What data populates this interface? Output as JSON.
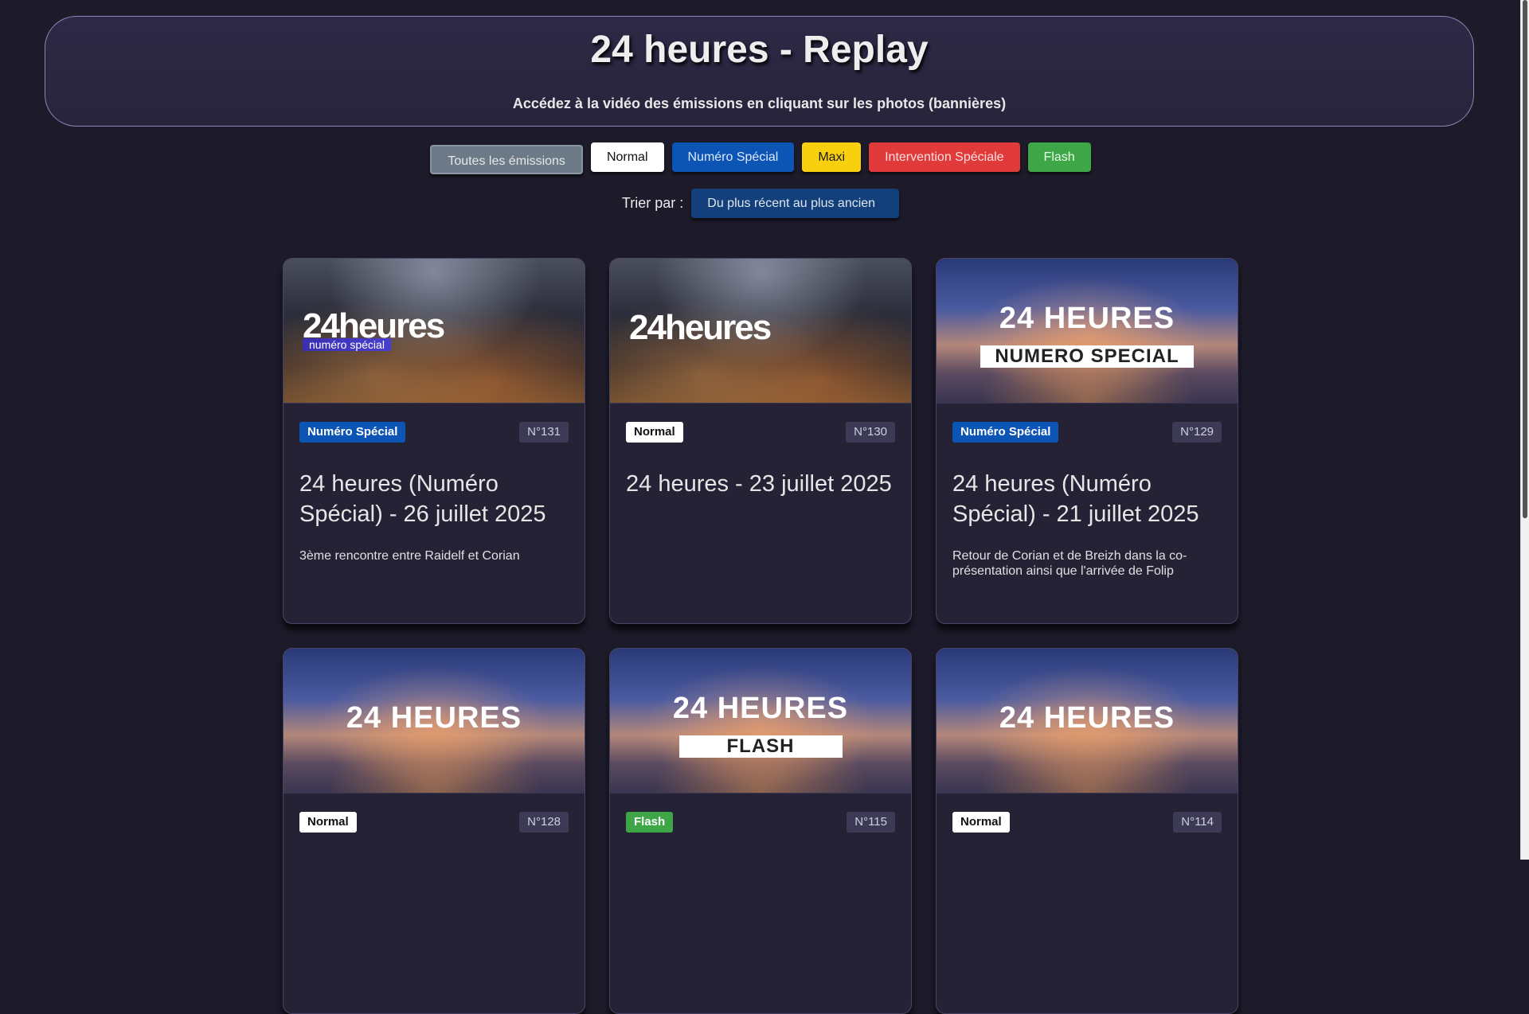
{
  "header": {
    "title": "24 heures - Replay",
    "subtitle": "Accédez à la vidéo des émissions en cliquant sur les photos (bannières)"
  },
  "filters": {
    "all": "Toutes les émissions",
    "normal": "Normal",
    "special": "Numéro Spécial",
    "maxi": "Maxi",
    "intervention": "Intervention Spéciale",
    "flash": "Flash"
  },
  "sort": {
    "label": "Trier par :",
    "selected": "Du plus récent au plus ancien"
  },
  "cards": [
    {
      "logo": "24heures",
      "logo_sub": "numéro spécial",
      "badge": "Numéro Spécial",
      "number": "N°131",
      "title": "24 heures (Numéro Spécial) - 26 juillet 2025",
      "description": "3ème rencontre entre Raidelf et Corian"
    },
    {
      "logo": "24heures",
      "badge": "Normal",
      "number": "N°130",
      "title": "24 heures - 23 juillet 2025",
      "description": ""
    },
    {
      "logo": "24 HEURES",
      "logo_sub": "NUMERO SPECIAL",
      "badge": "Numéro Spécial",
      "number": "N°129",
      "title": "24 heures (Numéro Spécial) - 21 juillet 2025",
      "description": "Retour de Corian et de Breizh dans la co-présentation ainsi que l'arrivée de Folip"
    },
    {
      "logo": "24 HEURES",
      "badge": "Normal",
      "number": "N°128",
      "title": "",
      "description": ""
    },
    {
      "logo": "24 HEURES",
      "logo_sub": "FLASH",
      "badge": "Flash",
      "number": "N°115",
      "title": "",
      "description": ""
    },
    {
      "logo": "24 HEURES",
      "badge": "Normal",
      "number": "N°114",
      "title": "",
      "description": ""
    }
  ]
}
